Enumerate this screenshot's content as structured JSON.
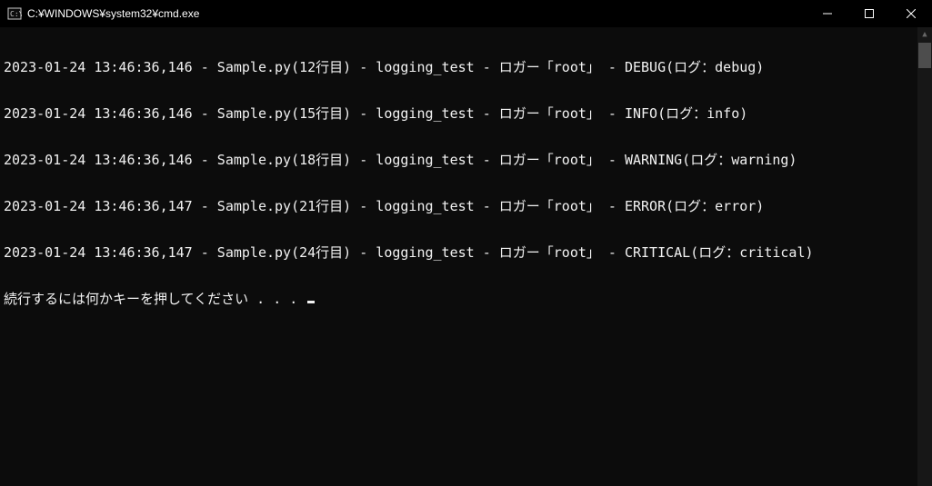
{
  "window": {
    "title": "C:¥WINDOWS¥system32¥cmd.exe"
  },
  "log_lines": [
    "2023-01-24 13:46:36,146 - Sample.py(12行目) - logging_test - ロガー「root」 - DEBUG(ログ：debug)",
    "2023-01-24 13:46:36,146 - Sample.py(15行目) - logging_test - ロガー「root」 - INFO(ログ：info)",
    "2023-01-24 13:46:36,146 - Sample.py(18行目) - logging_test - ロガー「root」 - WARNING(ログ：warning)",
    "2023-01-24 13:46:36,147 - Sample.py(21行目) - logging_test - ロガー「root」 - ERROR(ログ：error)",
    "2023-01-24 13:46:36,147 - Sample.py(24行目) - logging_test - ロガー「root」 - CRITICAL(ログ：critical)"
  ],
  "prompt": "続行するには何かキーを押してください . . . "
}
